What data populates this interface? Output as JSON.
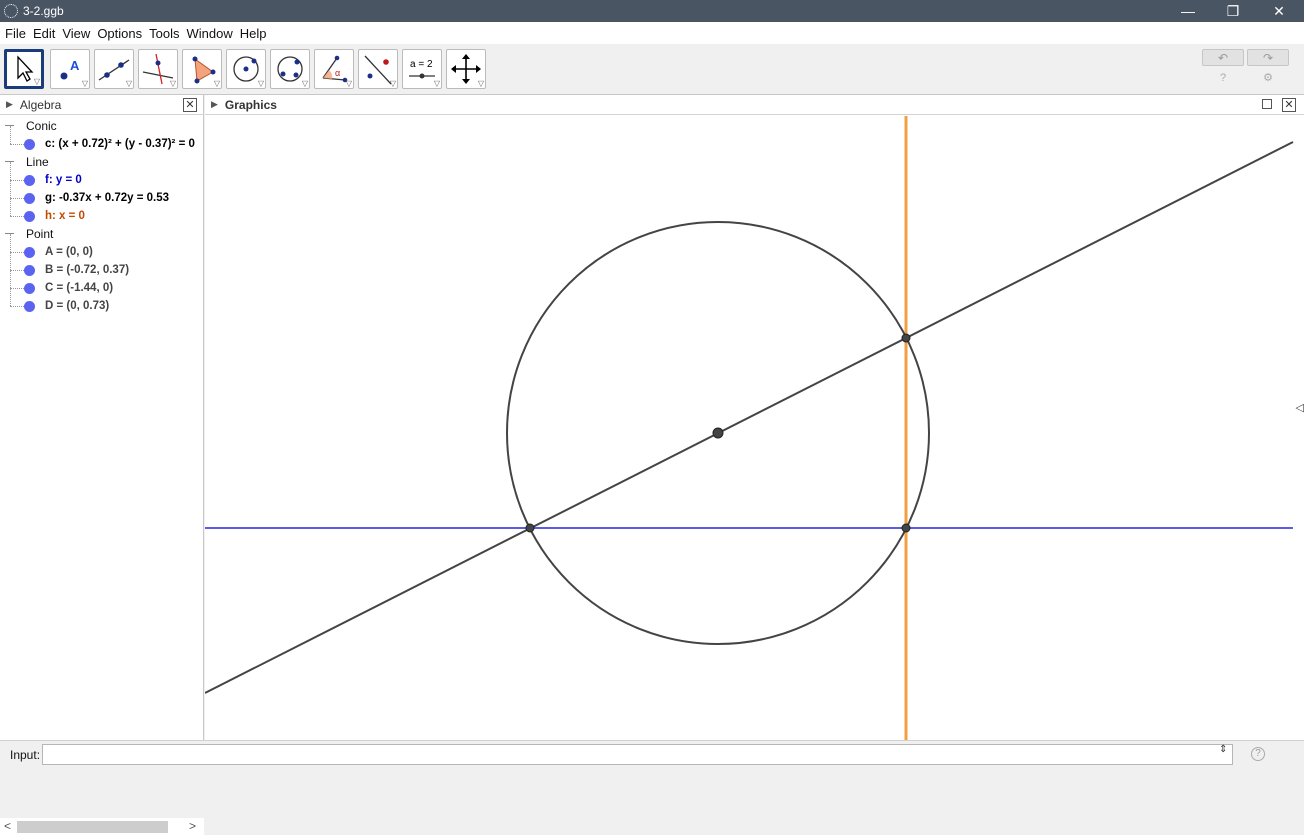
{
  "window": {
    "title": "3-2.ggb",
    "minimize_glyph": "—",
    "restore_glyph": "❐",
    "close_glyph": "✕"
  },
  "menu": [
    "File",
    "Edit",
    "View",
    "Options",
    "Tools",
    "Window",
    "Help"
  ],
  "toolbar": {
    "tools": [
      {
        "name": "move-tool",
        "icon": "arrow-cursor-icon"
      },
      {
        "name": "point-tool",
        "icon": "point-icon",
        "label": "A"
      },
      {
        "name": "line-tool",
        "icon": "line-through-two-points-icon"
      },
      {
        "name": "perpendicular-line-tool",
        "icon": "perpendicular-line-icon"
      },
      {
        "name": "polygon-tool",
        "icon": "polygon-icon"
      },
      {
        "name": "circle-center-point-tool",
        "icon": "circle-center-icon"
      },
      {
        "name": "circle-three-points-tool",
        "icon": "circle-three-points-icon"
      },
      {
        "name": "angle-tool",
        "icon": "angle-icon",
        "label": "α"
      },
      {
        "name": "reflect-tool",
        "icon": "reflect-about-line-icon"
      },
      {
        "name": "slider-tool",
        "icon": "slider-icon",
        "label": "a = 2"
      },
      {
        "name": "move-graphics-view-tool",
        "icon": "move-view-icon"
      }
    ],
    "undo_glyph": "↶",
    "redo_glyph": "↷",
    "help_glyph": "?",
    "settings_glyph": "⚙"
  },
  "algebra": {
    "title": "Algebra",
    "close_glyph": "✕",
    "groups": [
      {
        "label": "Conic",
        "items": [
          {
            "label": "c: (x + 0.72)² + (y - 0.37)² = 0",
            "color": "#000000"
          }
        ]
      },
      {
        "label": "Line",
        "items": [
          {
            "label": "f: y = 0",
            "color": "#0000cc"
          },
          {
            "label": "g: -0.37x + 0.72y = 0.53",
            "color": "#000000"
          },
          {
            "label": "h: x = 0",
            "color": "#c24a00"
          }
        ]
      },
      {
        "label": "Point",
        "items": [
          {
            "label": "A = (0, 0)",
            "color": "#444444"
          },
          {
            "label": "B = (-0.72, 0.37)",
            "color": "#444444"
          },
          {
            "label": "C = (-1.44, 0)",
            "color": "#444444"
          },
          {
            "label": "D = (0, 0.73)",
            "color": "#444444"
          }
        ]
      }
    ],
    "scroll_left": "<",
    "scroll_right": ">"
  },
  "graphics": {
    "title": "Graphics",
    "close_glyph": "✕",
    "colors": {
      "circle": "#444444",
      "line_f": "#5b5be6",
      "line_g": "#444444",
      "line_h": "#f0a040",
      "point": "#333333"
    }
  },
  "input": {
    "label": "Input:",
    "value": "",
    "spin_glyph": "⇕",
    "help_glyph": "?"
  }
}
